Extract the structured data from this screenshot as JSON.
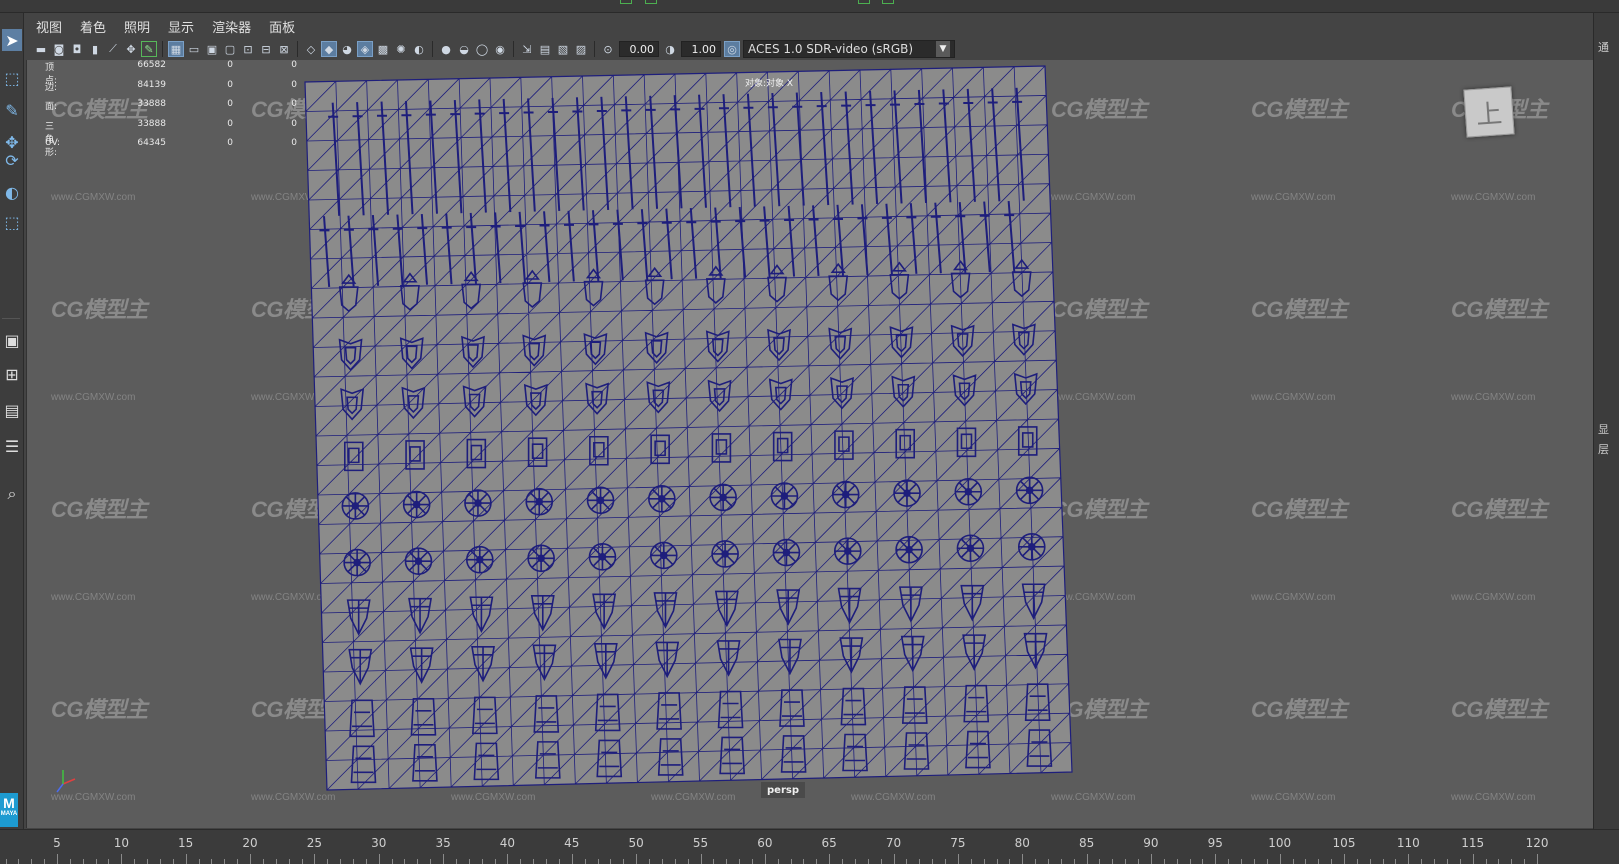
{
  "menu": [
    "视图",
    "着色",
    "照明",
    "显示",
    "渲染器",
    "面板"
  ],
  "iconbar": {
    "exposure_value": "0.00",
    "gamma_value": "1.00",
    "color_space": "ACES 1.0 SDR-video (sRGB)"
  },
  "hud": {
    "rows": [
      {
        "label": "顶点:",
        "v1": "66582",
        "v2": "0",
        "v3": "0"
      },
      {
        "label": "边:",
        "v1": "84139",
        "v2": "0",
        "v3": "0"
      },
      {
        "label": "面:",
        "v1": "33888",
        "v2": "0",
        "v3": "0"
      },
      {
        "label": "三角形:",
        "v1": "33888",
        "v2": "0",
        "v3": "0"
      },
      {
        "label": "UV:",
        "v1": "64345",
        "v2": "0",
        "v3": "0"
      }
    ]
  },
  "mesh_label": "对象:对象 X",
  "viewcube_label": "上",
  "camera_label": "persp",
  "watermark": {
    "logo_text": "CG模型主",
    "url_text": "www.CGMXW.com"
  },
  "toolbox": {
    "logo_label": "M",
    "logo_sub": "MAYA"
  },
  "right_panel": [
    "通",
    "显",
    "层"
  ],
  "timeline": {
    "labels": [
      "5",
      "10",
      "15",
      "20",
      "25",
      "30",
      "35",
      "40",
      "45",
      "50",
      "55",
      "60",
      "65",
      "70",
      "75",
      "80",
      "85",
      "90",
      "95",
      "100",
      "105",
      "110",
      "115",
      "120"
    ]
  },
  "colors": {
    "wire": "#1e1e7c",
    "viewport_bg": "#5c5c5c",
    "mesh_face": "#8b8b8b",
    "accent": "#5d7fa3"
  }
}
